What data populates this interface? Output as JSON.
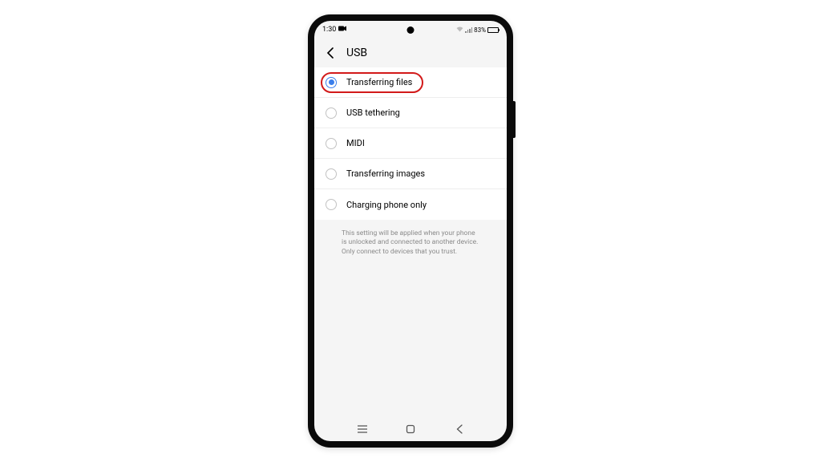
{
  "status": {
    "time": "1:30",
    "battery_pct": "83%"
  },
  "header": {
    "title": "USB"
  },
  "options": [
    {
      "label": "Transferring files",
      "selected": true,
      "highlighted": true
    },
    {
      "label": "USB tethering",
      "selected": false
    },
    {
      "label": "MIDI",
      "selected": false
    },
    {
      "label": "Transferring images",
      "selected": false
    },
    {
      "label": "Charging phone only",
      "selected": false
    }
  ],
  "footnote": "This setting will be applied when your phone is unlocked and connected to another device. Only connect to devices that you trust."
}
